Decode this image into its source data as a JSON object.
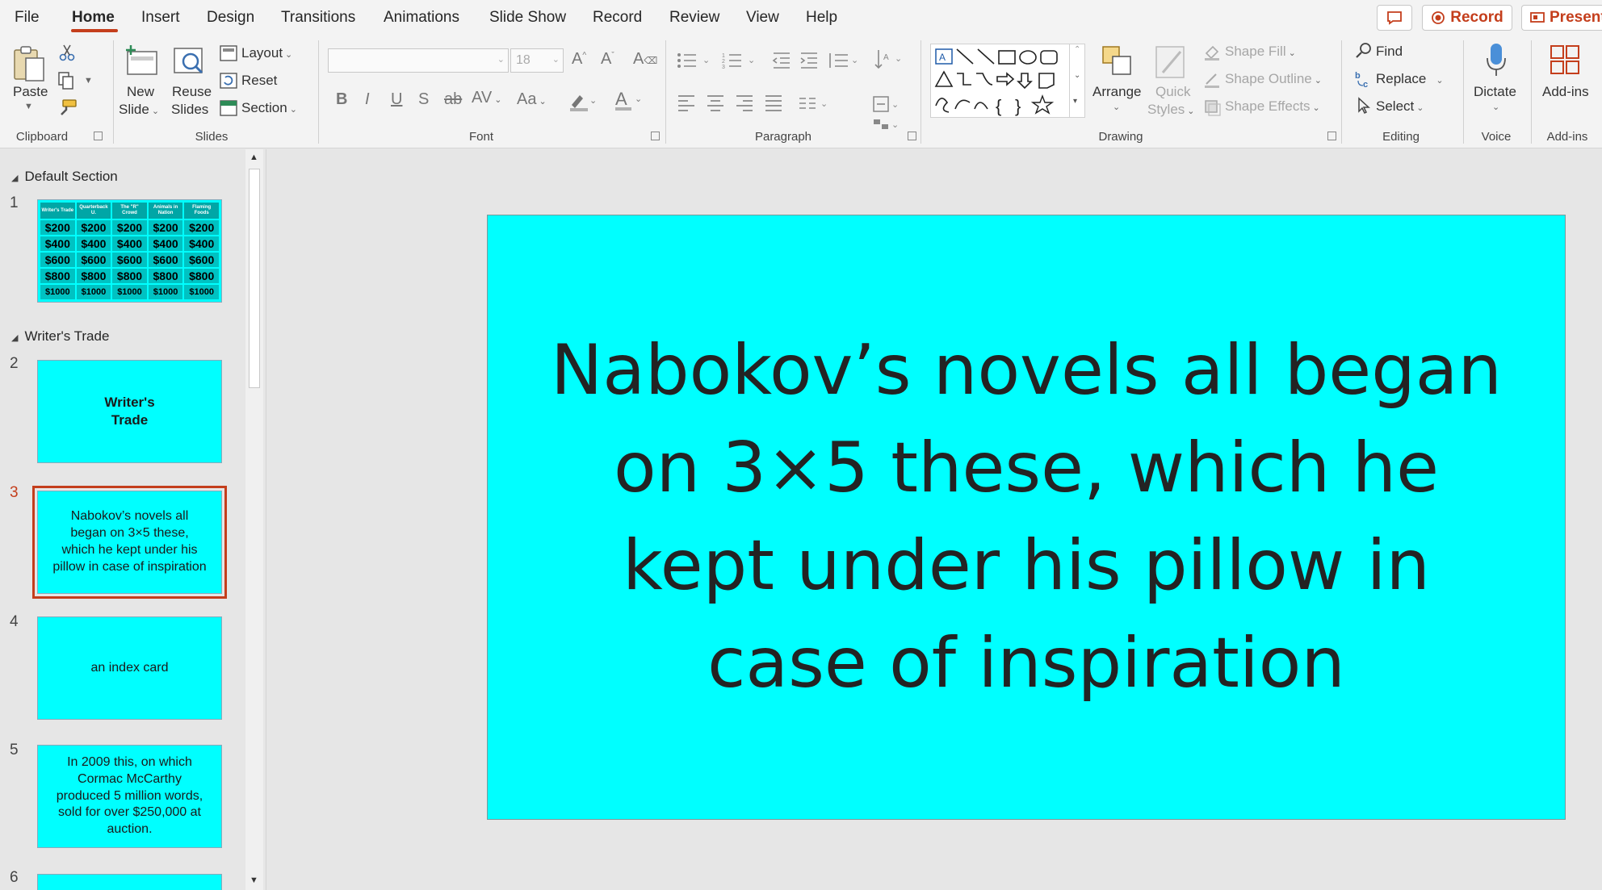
{
  "menu": {
    "tabs": [
      "File",
      "Home",
      "Insert",
      "Design",
      "Transitions",
      "Animations",
      "Slide Show",
      "Record",
      "Review",
      "View",
      "Help"
    ],
    "active_tab": "Home",
    "record_button": "Record",
    "present_button": "Present"
  },
  "ribbon": {
    "clipboard": {
      "paste": "Paste",
      "label": "Clipboard"
    },
    "slides": {
      "new_slide_1": "New",
      "new_slide_2": "Slide",
      "reuse_1": "Reuse",
      "reuse_2": "Slides",
      "layout": "Layout",
      "reset": "Reset",
      "section": "Section",
      "label": "Slides"
    },
    "font": {
      "font_size": "18",
      "label": "Font"
    },
    "paragraph": {
      "label": "Paragraph"
    },
    "drawing": {
      "arrange": "Arrange",
      "quick_styles_1": "Quick",
      "quick_styles_2": "Styles",
      "shape_fill": "Shape Fill",
      "shape_outline": "Shape Outline",
      "shape_effects": "Shape Effects",
      "label": "Drawing"
    },
    "editing": {
      "find": "Find",
      "replace": "Replace",
      "select": "Select",
      "label": "Editing"
    },
    "voice": {
      "dictate": "Dictate",
      "label": "Voice"
    },
    "addins": {
      "addins": "Add-ins",
      "label": "Add-ins"
    }
  },
  "thumbnails": {
    "sections": [
      {
        "name": "Default Section"
      },
      {
        "name": "Writer's Trade"
      }
    ],
    "slide1": {
      "number": "1",
      "headers": [
        "Writer's Trade",
        "Quarterback U.",
        "The \"R\" Crowd",
        "Animals in Nation",
        "Flaming Foods"
      ],
      "rows": [
        "$200",
        "$400",
        "$600",
        "$800",
        "$1000"
      ]
    },
    "slides": [
      {
        "number": "2",
        "text": "Writer's Trade"
      },
      {
        "number": "3",
        "text": "Nabokov’s novels all began on 3×5 these, which he kept under his pillow in case of inspiration"
      },
      {
        "number": "4",
        "text": "an index card"
      },
      {
        "number": "5",
        "text": "In 2009 this, on which Cormac McCarthy produced 5 million words, sold for over $250,000 at auction."
      },
      {
        "number": "6",
        "text": ""
      }
    ]
  },
  "main_slide": {
    "text": "Nabokov’s novels all began on 3×5 these, which he kept under his pillow in case of inspiration",
    "background": "#00ffff"
  },
  "colors": {
    "accent": "#c43e1c",
    "slide_bg": "#00ffff"
  }
}
